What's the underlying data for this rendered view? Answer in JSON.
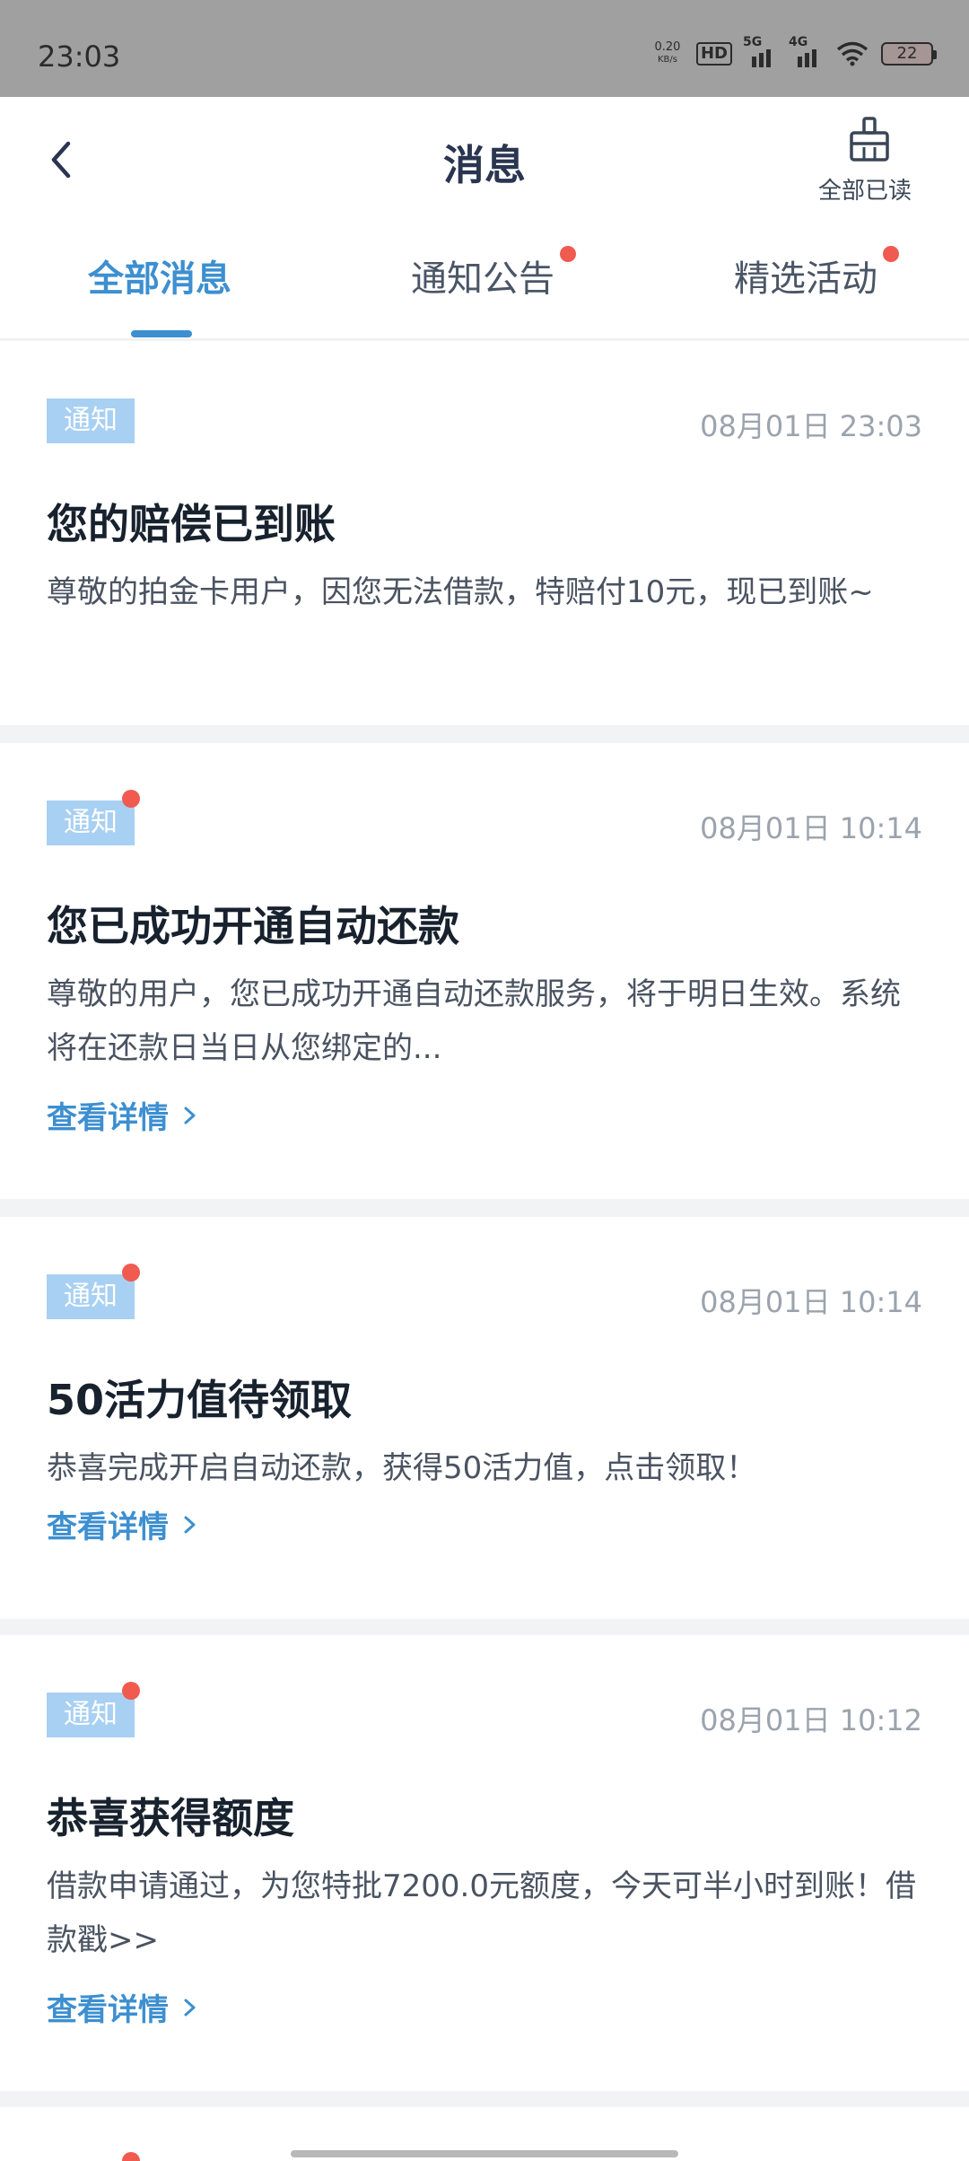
{
  "status_bar": {
    "time": "23:03",
    "net_speed_value": "0.20",
    "net_speed_unit": "KB/s",
    "hd_label": "HD",
    "signal_1": "5G",
    "signal_2": "4G",
    "battery": "22"
  },
  "header": {
    "title": "消息",
    "read_all_label": "全部已读"
  },
  "tabs": [
    {
      "label": "全部消息",
      "active": true,
      "has_dot": false
    },
    {
      "label": "通知公告",
      "active": false,
      "has_dot": true
    },
    {
      "label": "精选活动",
      "active": false,
      "has_dot": true
    }
  ],
  "messages": [
    {
      "badge": "通知",
      "unread": false,
      "time": "08月01日 23:03",
      "title": "您的赔偿已到账",
      "body": "尊敬的拍金卡用户，因您无法借款，特赔付10元，现已到账~",
      "detail_label": ""
    },
    {
      "badge": "通知",
      "unread": true,
      "time": "08月01日 10:14",
      "title": "您已成功开通自动还款",
      "body": "尊敬的用户，您已成功开通自动还款服务，将于明日生效。系统将在还款日当日从您绑定的...",
      "detail_label": "查看详情"
    },
    {
      "badge": "通知",
      "unread": true,
      "time": "08月01日 10:14",
      "title": "50活力值待领取",
      "body": "恭喜完成开启自动还款，获得50活力值，点击领取！",
      "detail_label": "查看详情"
    },
    {
      "badge": "通知",
      "unread": true,
      "time": "08月01日 10:12",
      "title": "恭喜获得额度",
      "body": "借款申请通过，为您特批7200.0元额度，今天可半小时到账！借款戳>>",
      "detail_label": "查看详情"
    }
  ],
  "colors": {
    "accent": "#3d8fd0",
    "badge_bg": "#a8d0f2",
    "unread_dot": "#f05a4f"
  }
}
